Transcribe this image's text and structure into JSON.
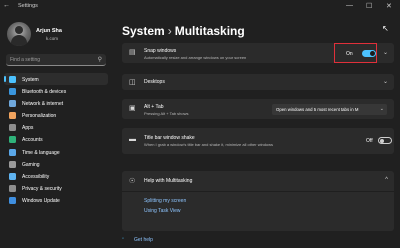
{
  "window": {
    "title": "Settings",
    "back_glyph": "←",
    "minimize_glyph": "—",
    "maximize_glyph": "☐",
    "close_glyph": "✕"
  },
  "user": {
    "name": "Arjun Sha",
    "email": "k.com"
  },
  "search": {
    "placeholder": "Find a setting",
    "icon": "search-icon"
  },
  "nav": [
    {
      "label": "System",
      "color": "#4cc2ff",
      "icon": "system-icon"
    },
    {
      "label": "Bluetooth & devices",
      "color": "#3a96dd",
      "icon": "bluetooth-icon"
    },
    {
      "label": "Network & internet",
      "color": "#6fa8dc",
      "icon": "wifi-icon"
    },
    {
      "label": "Personalization",
      "color": "#f0a35e",
      "icon": "brush-icon"
    },
    {
      "label": "Apps",
      "color": "#8e8e8e",
      "icon": "apps-icon"
    },
    {
      "label": "Accounts",
      "color": "#2fb27a",
      "icon": "person-icon"
    },
    {
      "label": "Time & language",
      "color": "#5aa7e8",
      "icon": "clock-icon"
    },
    {
      "label": "Gaming",
      "color": "#9a9a9a",
      "icon": "gamepad-icon"
    },
    {
      "label": "Accessibility",
      "color": "#5fb3f0",
      "icon": "accessibility-icon"
    },
    {
      "label": "Privacy & security",
      "color": "#8f8f8f",
      "icon": "shield-icon"
    },
    {
      "label": "Windows Update",
      "color": "#3f8fe0",
      "icon": "update-icon"
    }
  ],
  "breadcrumb": {
    "parent": "System",
    "separator": "›",
    "current": "Multitasking"
  },
  "snap": {
    "title": "Snap windows",
    "subtitle": "Automatically resize and arrange windows on your screen",
    "state": "On",
    "icon": "snap-icon",
    "expand_glyph": "⌄"
  },
  "desktops": {
    "title": "Desktops",
    "icon": "desktops-icon",
    "expand_glyph": "⌄"
  },
  "alttab": {
    "title": "Alt + Tab",
    "subtitle": "Pressing Alt + Tab shows",
    "value": "Open windows and 5 most recent tabs in M",
    "icon": "alttab-icon"
  },
  "shake": {
    "title": "Title bar window shake",
    "subtitle": "When I grab a window's title bar and shake it, minimize all other windows",
    "state": "Off",
    "icon": "shake-icon"
  },
  "help": {
    "title": "Help with Multitasking",
    "links": [
      "Splitting my screen",
      "Using Task View"
    ],
    "icon": "globe-icon",
    "collapse_glyph": "^"
  },
  "gethelp": {
    "label": "Get help",
    "icon": "help-icon"
  },
  "accent_color": "#4cc2ff"
}
